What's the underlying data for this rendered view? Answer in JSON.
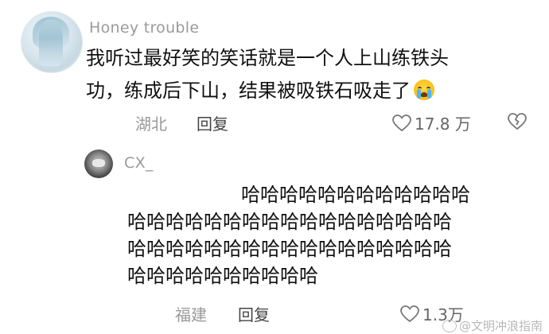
{
  "comment": {
    "username": "Honey trouble",
    "text_line1": "我听过最好笑的笑话就是一个人上山练铁头",
    "text_line2": "功，练成后下山，结果被吸铁石吸走了",
    "emoji": "loudly-crying-face",
    "location": "湖北",
    "reply_label": "回复",
    "likes": "17.8 万"
  },
  "reply": {
    "username": "CX_",
    "lines": [
      "哈哈哈哈哈哈哈哈哈哈哈哈",
      "哈哈哈哈哈哈哈哈哈哈哈哈哈哈哈哈哈",
      "哈哈哈哈哈哈哈哈哈哈哈哈哈哈哈哈哈",
      "哈哈哈哈哈哈哈哈哈哈"
    ],
    "location": "福建",
    "reply_label": "回复",
    "likes": "1.3万"
  },
  "watermark": "@文明冲浪指南",
  "colors": {
    "text": "#111111",
    "muted": "#9a9a9a",
    "background": "#ffffff"
  }
}
